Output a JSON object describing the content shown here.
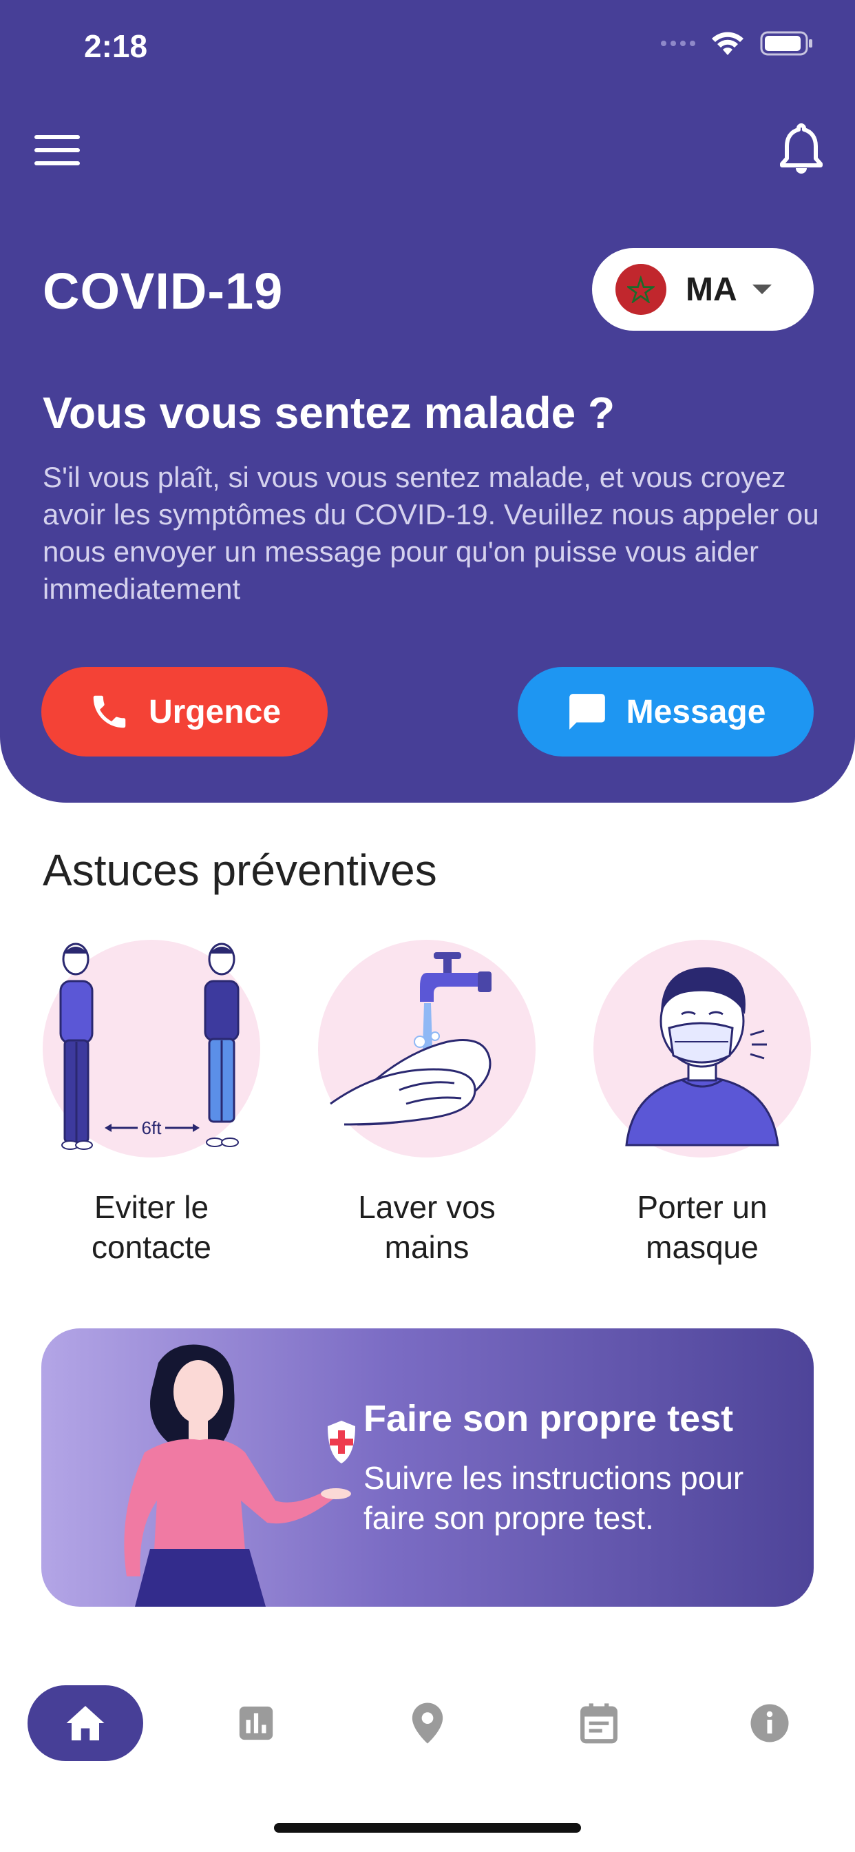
{
  "status_bar": {
    "time": "2:18"
  },
  "header": {
    "title": "COVID-19",
    "country": {
      "code": "MA"
    },
    "headline": "Vous vous sentez malade ?",
    "description": "S'il vous plaît, si vous vous sentez malade, et vous croyez avoir les symptômes du COVID-19. Veuillez nous appeler ou nous envoyer un message pour qu'on puisse vous aider immediatement",
    "buttons": {
      "urgence": "Urgence",
      "message": "Message"
    }
  },
  "tips": {
    "title": "Astuces préventives",
    "items": [
      {
        "label": "Eviter le contacte",
        "distance": "6ft",
        "icon": "distancing-illustration"
      },
      {
        "label": "Laver vos mains",
        "icon": "handwashing-illustration"
      },
      {
        "label": "Porter un masque",
        "icon": "mask-illustration"
      }
    ]
  },
  "self_test": {
    "title": "Faire son propre test",
    "subtitle": "Suivre les instructions pour faire son propre test."
  },
  "bottom_nav": {
    "items": [
      "home-icon",
      "stats-icon",
      "location-icon",
      "calendar-icon",
      "info-icon"
    ],
    "active": "home-icon"
  },
  "colors": {
    "primary": "#473f97",
    "urgence": "#f44236",
    "message": "#1e96f2",
    "tip_circle": "#fbe4ef"
  }
}
